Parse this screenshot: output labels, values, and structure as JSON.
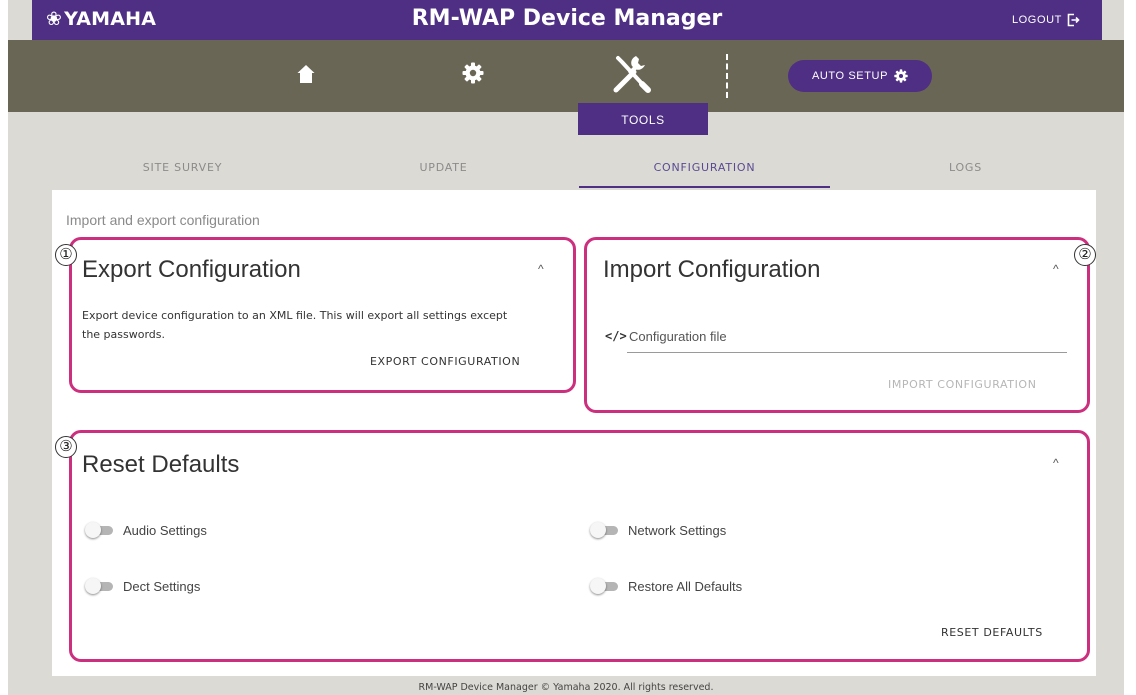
{
  "header": {
    "brand_mark": "❀",
    "brand": "YAMAHA",
    "app_title": "RM-WAP Device Manager",
    "logout_label": "LOGOUT",
    "colors": {
      "brand_purple": "#4e2f83",
      "toolbar": "#6a6656",
      "callout": "#cc2f7e"
    }
  },
  "toolbar": {
    "icons": [
      "home-icon",
      "gear-icon",
      "tools-icon"
    ],
    "auto_setup_label": "AUTO SETUP",
    "active_tab_label": "TOOLS"
  },
  "subtabs": [
    {
      "label": "SITE SURVEY",
      "active": false
    },
    {
      "label": "UPDATE",
      "active": false
    },
    {
      "label": "CONFIGURATION",
      "active": true
    },
    {
      "label": "LOGS",
      "active": false
    }
  ],
  "main": {
    "section_title": "Import and export configuration",
    "export": {
      "callout": "①",
      "title": "Export Configuration",
      "description_line1": "Export device configuration to an XML file. This will export all settings except",
      "description_line2": "the passwords.",
      "button": "EXPORT CONFIGURATION"
    },
    "import": {
      "callout": "②",
      "title": "Import Configuration",
      "file_label": "Configuration file",
      "button": "IMPORT CONFIGURATION"
    },
    "reset": {
      "callout": "③",
      "title": "Reset Defaults",
      "toggles": [
        {
          "label": "Audio Settings",
          "on": false
        },
        {
          "label": "Network Settings",
          "on": false
        },
        {
          "label": "Dect Settings",
          "on": false
        },
        {
          "label": "Restore All Defaults",
          "on": false
        }
      ],
      "button": "RESET DEFAULTS"
    }
  },
  "footer": {
    "text": "RM-WAP Device Manager © Yamaha 2020. All rights reserved."
  }
}
